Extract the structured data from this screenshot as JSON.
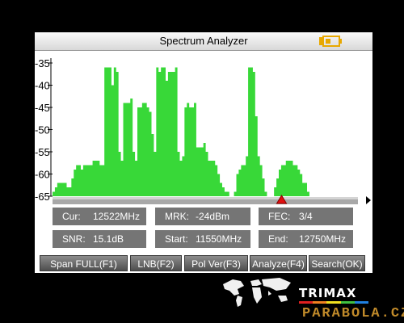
{
  "title": "Spectrum Analyzer",
  "chart_data": {
    "type": "area",
    "y_ticks": [
      "-35",
      "-40",
      "-45",
      "-50",
      "-55",
      "-60",
      "-65"
    ],
    "ylim": [
      -65,
      -35
    ],
    "xlim": [
      11550,
      12750
    ],
    "x": [
      11550,
      11560,
      11570,
      11580,
      11590,
      11600,
      11610,
      11620,
      11630,
      11640,
      11650,
      11660,
      11670,
      11680,
      11690,
      11700,
      11710,
      11720,
      11730,
      11740,
      11750,
      11760,
      11770,
      11780,
      11790,
      11800,
      11810,
      11820,
      11830,
      11840,
      11850,
      11860,
      11870,
      11880,
      11890,
      11900,
      11910,
      11920,
      11930,
      11940,
      11950,
      11960,
      11970,
      11980,
      11990,
      12000,
      12010,
      12020,
      12030,
      12040,
      12050,
      12060,
      12070,
      12080,
      12090,
      12100,
      12110,
      12120,
      12130,
      12140,
      12150,
      12160,
      12170,
      12180,
      12190,
      12200,
      12210,
      12220,
      12230,
      12240,
      12250,
      12260,
      12270,
      12280,
      12290,
      12300,
      12310,
      12320,
      12330,
      12340,
      12350,
      12360,
      12370,
      12380,
      12390,
      12400,
      12410,
      12420,
      12430,
      12440,
      12450,
      12460,
      12470,
      12480,
      12490,
      12500,
      12510,
      12520,
      12530,
      12540,
      12550,
      12560,
      12570,
      12580,
      12590,
      12600,
      12610,
      12620,
      12630,
      12640,
      12650,
      12660,
      12670,
      12680,
      12690,
      12700,
      12710,
      12720,
      12730,
      12740,
      12750
    ],
    "y": [
      -64,
      -63,
      -62,
      -62,
      -62,
      -62,
      -63,
      -63,
      -61,
      -59,
      -58,
      -58,
      -59,
      -58,
      -58,
      -58,
      -58,
      -57,
      -57,
      -57,
      -58,
      -58,
      -36,
      -36,
      -36,
      -40,
      -36,
      -37,
      -55,
      -57,
      -44,
      -44,
      -44,
      -43,
      -55,
      -57,
      -45,
      -45,
      -44,
      -44,
      -45,
      -46,
      -51,
      -55,
      -36,
      -37,
      -36,
      -36,
      -39,
      -37,
      -37,
      -37,
      -36,
      -55,
      -57,
      -56,
      -45,
      -44,
      -45,
      -45,
      -44,
      -54,
      -54,
      -54,
      -53,
      -55,
      -57,
      -57,
      -57,
      -58,
      -60,
      -62,
      -63,
      -64,
      -64,
      -65,
      -65,
      -64,
      -60,
      -59,
      -58,
      -58,
      -56,
      -36,
      -36,
      -37,
      -47,
      -56,
      -58,
      -61,
      -64,
      -65,
      -65,
      -65,
      -63,
      -61,
      -59,
      -58,
      -58,
      -57,
      -57,
      -57,
      -58,
      -58,
      -59,
      -60,
      -62,
      -62,
      -64,
      -65,
      -65,
      -65,
      -65,
      -65,
      -65,
      -65,
      -65,
      -65,
      -65,
      -65,
      -65
    ],
    "marker_mhz": 12522,
    "fill_color": "#38d838"
  },
  "info": {
    "cur": {
      "label": "Cur:",
      "value": "12522MHz"
    },
    "mrk": {
      "label": "MRK:",
      "value": "-24dBm"
    },
    "fec": {
      "label": "FEC:",
      "value": "3/4"
    },
    "snr": {
      "label": "SNR:",
      "value": "15.1dB"
    },
    "start": {
      "label": "Start:",
      "value": "11550MHz"
    },
    "end": {
      "label": "End:",
      "value": "12750MHz"
    }
  },
  "buttons": {
    "span": "Span FULL(F1)",
    "lnb": "LNB(F2)",
    "pol": "Pol Ver(F3)",
    "analyze": "Analyze(F4)",
    "search": "Search(OK)"
  },
  "brand": "TRIMAX",
  "watermark": "PARABOLA.CZ",
  "icons": {
    "battery": "battery-icon",
    "map": "world-map-icon",
    "marker": "marker-triangle-icon",
    "arrow": "arrow-right-icon"
  }
}
